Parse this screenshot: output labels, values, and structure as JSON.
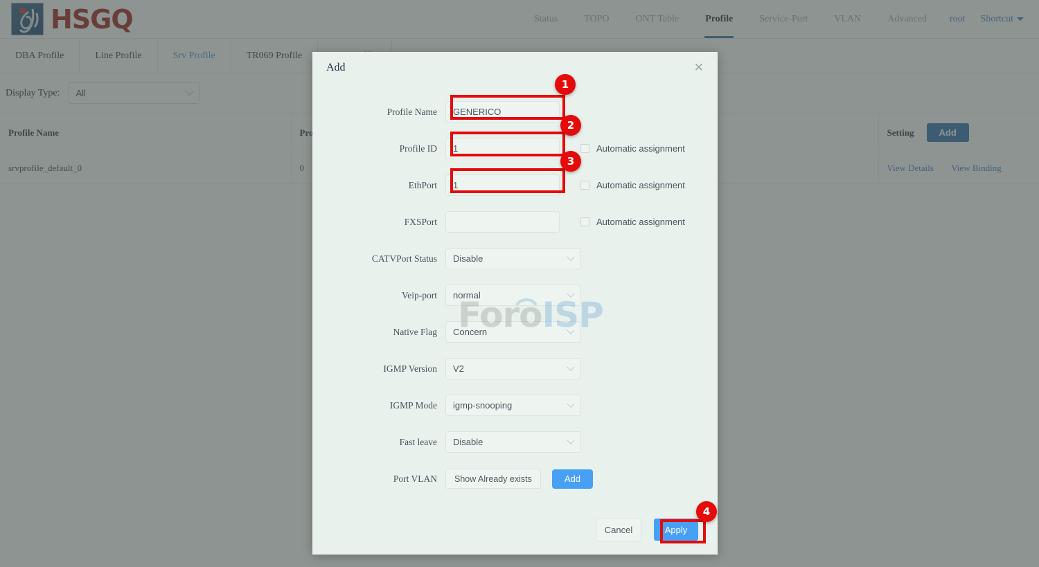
{
  "header": {
    "brand": "HSGQ",
    "logo_icon": "hsgq-droplet-logo",
    "nav": [
      {
        "label": "Status",
        "active": false
      },
      {
        "label": "TOPO",
        "active": false
      },
      {
        "label": "ONT Table",
        "active": false
      },
      {
        "label": "Profile",
        "active": true
      },
      {
        "label": "Service-Port",
        "active": false
      },
      {
        "label": "VLAN",
        "active": false
      },
      {
        "label": "Advanced",
        "active": false
      }
    ],
    "user": "root",
    "shortcut": "Shortcut"
  },
  "tabs": [
    {
      "label": "DBA Profile",
      "active": false
    },
    {
      "label": "Line Profile",
      "active": false
    },
    {
      "label": "Srv Profile",
      "active": true
    },
    {
      "label": "TR069 Profile",
      "active": false
    },
    {
      "label": "SIP Profile",
      "active": false
    }
  ],
  "filter": {
    "label": "Display Type:",
    "value": "All"
  },
  "table": {
    "columns": [
      "Profile Name",
      "Profile ID",
      "Setting"
    ],
    "add_button": "Add",
    "rows": [
      {
        "profile_name": "srvprofile_default_0",
        "profile_id": "0",
        "actions": [
          "View Details",
          "View Binding"
        ]
      }
    ]
  },
  "modal": {
    "title": "Add",
    "close_icon": "close-icon",
    "fields": {
      "profile_name": {
        "label": "Profile Name",
        "value": "GENERICO"
      },
      "profile_id": {
        "label": "Profile ID",
        "value": "1",
        "checkbox": "Automatic assignment"
      },
      "ethport": {
        "label": "EthPort",
        "value": "1",
        "checkbox": "Automatic assignment"
      },
      "fxsport": {
        "label": "FXSPort",
        "value": "",
        "checkbox": "Automatic assignment"
      },
      "catvport_status": {
        "label": "CATVPort Status",
        "value": "Disable"
      },
      "veip_port": {
        "label": "Veip-port",
        "value": "normal"
      },
      "native_flag": {
        "label": "Native Flag",
        "value": "Concern"
      },
      "igmp_version": {
        "label": "IGMP Version",
        "value": "V2"
      },
      "igmp_mode": {
        "label": "IGMP Mode",
        "value": "igmp-snooping"
      },
      "fast_leave": {
        "label": "Fast leave",
        "value": "Disable"
      },
      "port_vlan": {
        "label": "Port VLAN",
        "show_button": "Show Already exists",
        "add_button": "Add"
      }
    },
    "footer": {
      "cancel": "Cancel",
      "apply": "Apply"
    }
  },
  "annotations": {
    "badges": [
      "1",
      "2",
      "3",
      "4"
    ],
    "highlight_color": "#e50b0b"
  },
  "watermark": {
    "part1": "Foro",
    "part2": "ISP"
  },
  "colors": {
    "brand_red": "#9c1c1c",
    "accent_blue": "#48a0f5",
    "table_add_blue": "#2b6cb0",
    "modal_bg": "#e9f1ec",
    "overlay": "#707673"
  }
}
